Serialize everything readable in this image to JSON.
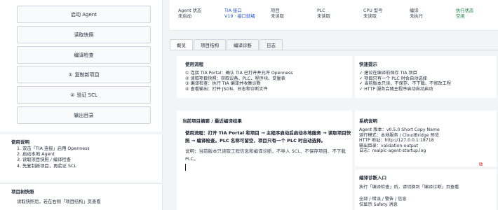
{
  "actions": {
    "start_agent": "启动 Agent",
    "read_snapshot": "读取快照",
    "compile_check": "编译检查",
    "copy_project": "复制新项目",
    "verify_scl": "验证 SCL",
    "export_dir": "输出目录"
  },
  "help": {
    "title": "使用说明",
    "steps": [
      "1. 双击「TIA 连接」启用 Openness",
      "2. 启动本地 Agent",
      "3. 读取项目快照 / 编译检查",
      "4. 先复制新项目，再验证 SCL"
    ]
  },
  "tree": {
    "title": "项目树快照",
    "body": "读取快照后，若在右侧「项目结构」页查看"
  },
  "status": [
    {
      "label": "Agent 状态",
      "value": "未启动",
      "tone": "normal"
    },
    {
      "label": "TIA 接口",
      "value": "V19 · 接口就绪",
      "tone": "blue"
    },
    {
      "label": "项目",
      "value": "未读取",
      "tone": "normal"
    },
    {
      "label": "PLC",
      "value": "未读取",
      "tone": "normal"
    },
    {
      "label": "CPU 型号",
      "value": "未读取",
      "tone": "normal"
    },
    {
      "label": "编译",
      "value": "未执行",
      "tone": "normal"
    },
    {
      "label": "执行状态",
      "value": "空闲",
      "tone": "green"
    }
  ],
  "tabs": [
    "概览",
    "项目结构",
    "编译诊断",
    "日志"
  ],
  "usage_flow": {
    "title": "使用流程",
    "lines": [
      "① 连接 TIA Portal：确认 TIA 已打开并允许 Openness",
      "② 读取项目快照：获取设备、PLC、程序块、变量表",
      "③ 编译检查：执行 TIA 编译并收集诊断",
      "④ 查看输出：打开 JSON、日志和诊断文件"
    ]
  },
  "quick_tips": {
    "title": "快速提示",
    "lines": [
      "✓ 建议在编译前保存 TIA 项目",
      "✓ 项目只有一个 PLC 时会自动选择",
      "✓ 当前版本只读、不保存、不下载、不修改工程",
      "✓ HTTP 服务会随主程序启动自动启动"
    ]
  },
  "summary": {
    "title": "当前项目摘要 / 最近编译结果",
    "main_bold": "使用流程：打开 TIA Portal 和项目 → 主程序启动后启动本地服务 → 读取项目快照 → 编译检查。PLC 名称可留空，项目只有一个 PLC 时自动选择。",
    "note": "说明：当前版本只读取工程信息和编译诊断，不导入 SCL、不保存项目、不下载 PLC。"
  },
  "system_info": {
    "title": "系统说明",
    "lines": [
      "Agent 版本：v0.5.0 Short Copy Name",
      "运行模式：本地服务 / CloudBridge 预览",
      "HTTP 地址：http://127.0.0.1:18718",
      "输出目录：validation-output",
      "日志：realplc-agent-startup.log"
    ]
  },
  "diagnose_entry": {
    "title": "编译诊断入口",
    "desc": "执行「编译检查」后，请切换到「编译诊断」页查看",
    "lines": [
      "全部 / 错误 / 警告 / 信息",
      "仅显示 Safety 消息"
    ]
  },
  "colors": {
    "blue": "#1d4ed8",
    "green": "#15803d",
    "copy_icon": "#ef4444"
  }
}
